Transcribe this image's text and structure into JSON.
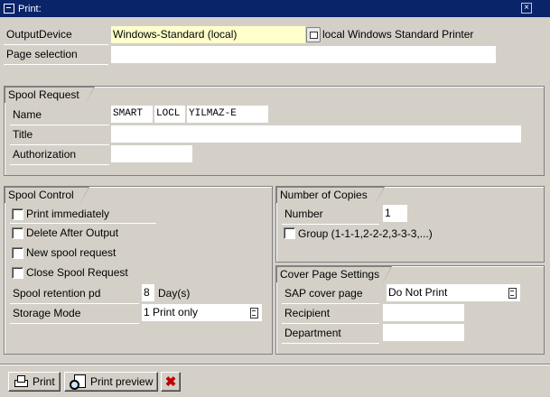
{
  "window": {
    "title": "Print:"
  },
  "output": {
    "device_label": "OutputDevice",
    "device_value": "Windows-Standard (local)",
    "device_desc": "local Windows Standard Printer",
    "page_selection_label": "Page selection",
    "page_selection_value": ""
  },
  "spool_request": {
    "title": "Spool Request",
    "name_label": "Name",
    "name_parts": [
      "SMART",
      "LOCL",
      "YILMAZ-E"
    ],
    "title_label": "Title",
    "title_value": "",
    "authorization_label": "Authorization",
    "authorization_value": ""
  },
  "spool_control": {
    "title": "Spool Control",
    "checkboxes": [
      {
        "label": "Print immediately",
        "checked": false
      },
      {
        "label": "Delete After Output",
        "checked": false
      },
      {
        "label": "New spool request",
        "checked": false
      },
      {
        "label": "Close Spool Request",
        "checked": false
      }
    ],
    "retention_label": "Spool retention pd",
    "retention_value": "8",
    "retention_unit": "Day(s)",
    "storage_label": "Storage Mode",
    "storage_value": "1 Print only"
  },
  "copies": {
    "title": "Number of Copies",
    "number_label": "Number",
    "number_value": "1",
    "group_label": "Group (1-1-1,2-2-2,3-3-3,...)",
    "group_checked": false
  },
  "cover_page": {
    "title": "Cover Page Settings",
    "sap_label": "SAP cover page",
    "sap_value": "Do Not Print",
    "recipient_label": "Recipient",
    "recipient_value": "",
    "department_label": "Department",
    "department_value": ""
  },
  "toolbar": {
    "print_label": "Print",
    "preview_label": "Print preview"
  }
}
